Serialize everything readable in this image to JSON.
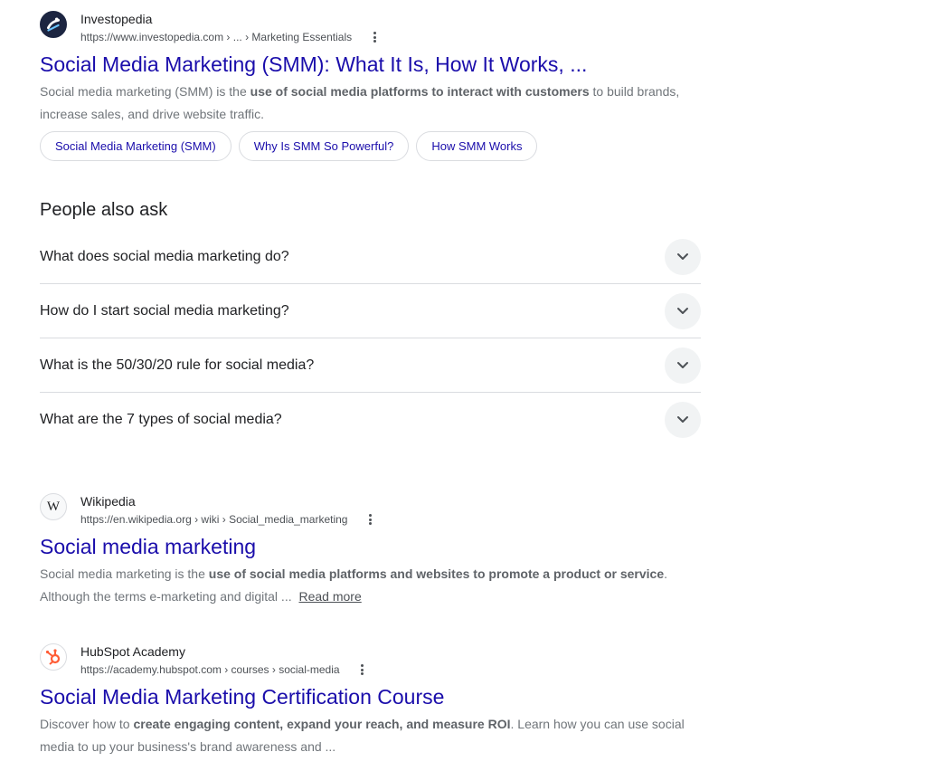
{
  "results": [
    {
      "site": "Investopedia",
      "url": "https://www.investopedia.com › ... › Marketing Essentials",
      "title": "Social Media Marketing (SMM): What It Is, How It Works, ...",
      "snippet": {
        "pre": "Social media marketing (SMM) is the ",
        "bold": "use of social media platforms to interact with customers",
        "post": " to build brands, increase sales, and drive website traffic."
      },
      "chips": [
        "Social Media Marketing (SMM)",
        "Why Is SMM So Powerful?",
        "How SMM Works"
      ]
    },
    {
      "site": "Wikipedia",
      "url": "https://en.wikipedia.org › wiki › Social_media_marketing",
      "title": "Social media marketing",
      "favicon_text": "W",
      "snippet": {
        "pre": "Social media marketing is the ",
        "bold": "use of social media platforms and websites to promote a product or service",
        "post": ". Although the terms e-marketing and digital ... "
      },
      "read_more": "Read more"
    },
    {
      "site": "HubSpot Academy",
      "url": "https://academy.hubspot.com › courses › social-media",
      "title": "Social Media Marketing Certification Course",
      "snippet": {
        "pre": "Discover how to ",
        "bold": "create engaging content, expand your reach, and measure ROI",
        "post": ". Learn how you can use social media to up your business's brand awareness and ..."
      }
    }
  ],
  "people_also_ask": {
    "heading": "People also ask",
    "questions": [
      "What does social media marketing do?",
      "How do I start social media marketing?",
      "What is the 50/30/20 rule for social media?",
      "What are the 7 types of social media?"
    ]
  },
  "icons": {
    "investopedia": "investopedia-logo-icon",
    "wikipedia": "wikipedia-logo-icon",
    "hubspot": "hubspot-logo-icon",
    "more": "more-vertical-icon",
    "expand": "chevron-down-icon"
  },
  "colors": {
    "link": "#1a0dab",
    "text": "#202124",
    "muted": "#70757a",
    "hubspot": "#ff5c35",
    "investopedia": "#1c2541"
  }
}
